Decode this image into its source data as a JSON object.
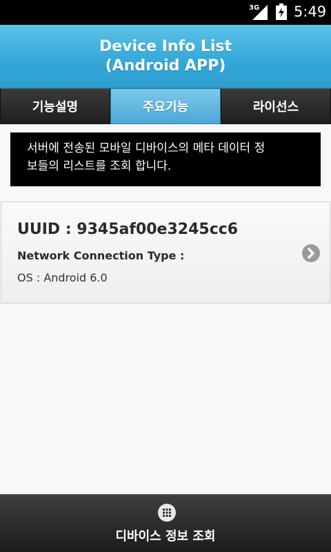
{
  "status_bar": {
    "network": "3G",
    "time": "5:49"
  },
  "header": {
    "title_line1": "Device Info List",
    "title_line2": "(Android APP)",
    "colors": {
      "accent": "#33a8d8",
      "tab_active": "#5fb6e0",
      "tab_dark": "#2a2a2a"
    }
  },
  "tabs": [
    {
      "label": "기능설명",
      "active": false
    },
    {
      "label": "주요기능",
      "active": true
    },
    {
      "label": "라이선스",
      "active": false
    }
  ],
  "description": {
    "line1": "서버에 전송된 모바일 디바이스의 메타 데이터 정",
    "line2": "보들의 리스트를 조회 합니다."
  },
  "device_list": [
    {
      "uuid": "UUID : 9345af00e3245cc6",
      "network_type": "Network Connection Type :",
      "os": "OS : Android 6.0"
    }
  ],
  "bottom_button": {
    "label": "디바이스 정보 조회",
    "icon": "grid-icon"
  }
}
